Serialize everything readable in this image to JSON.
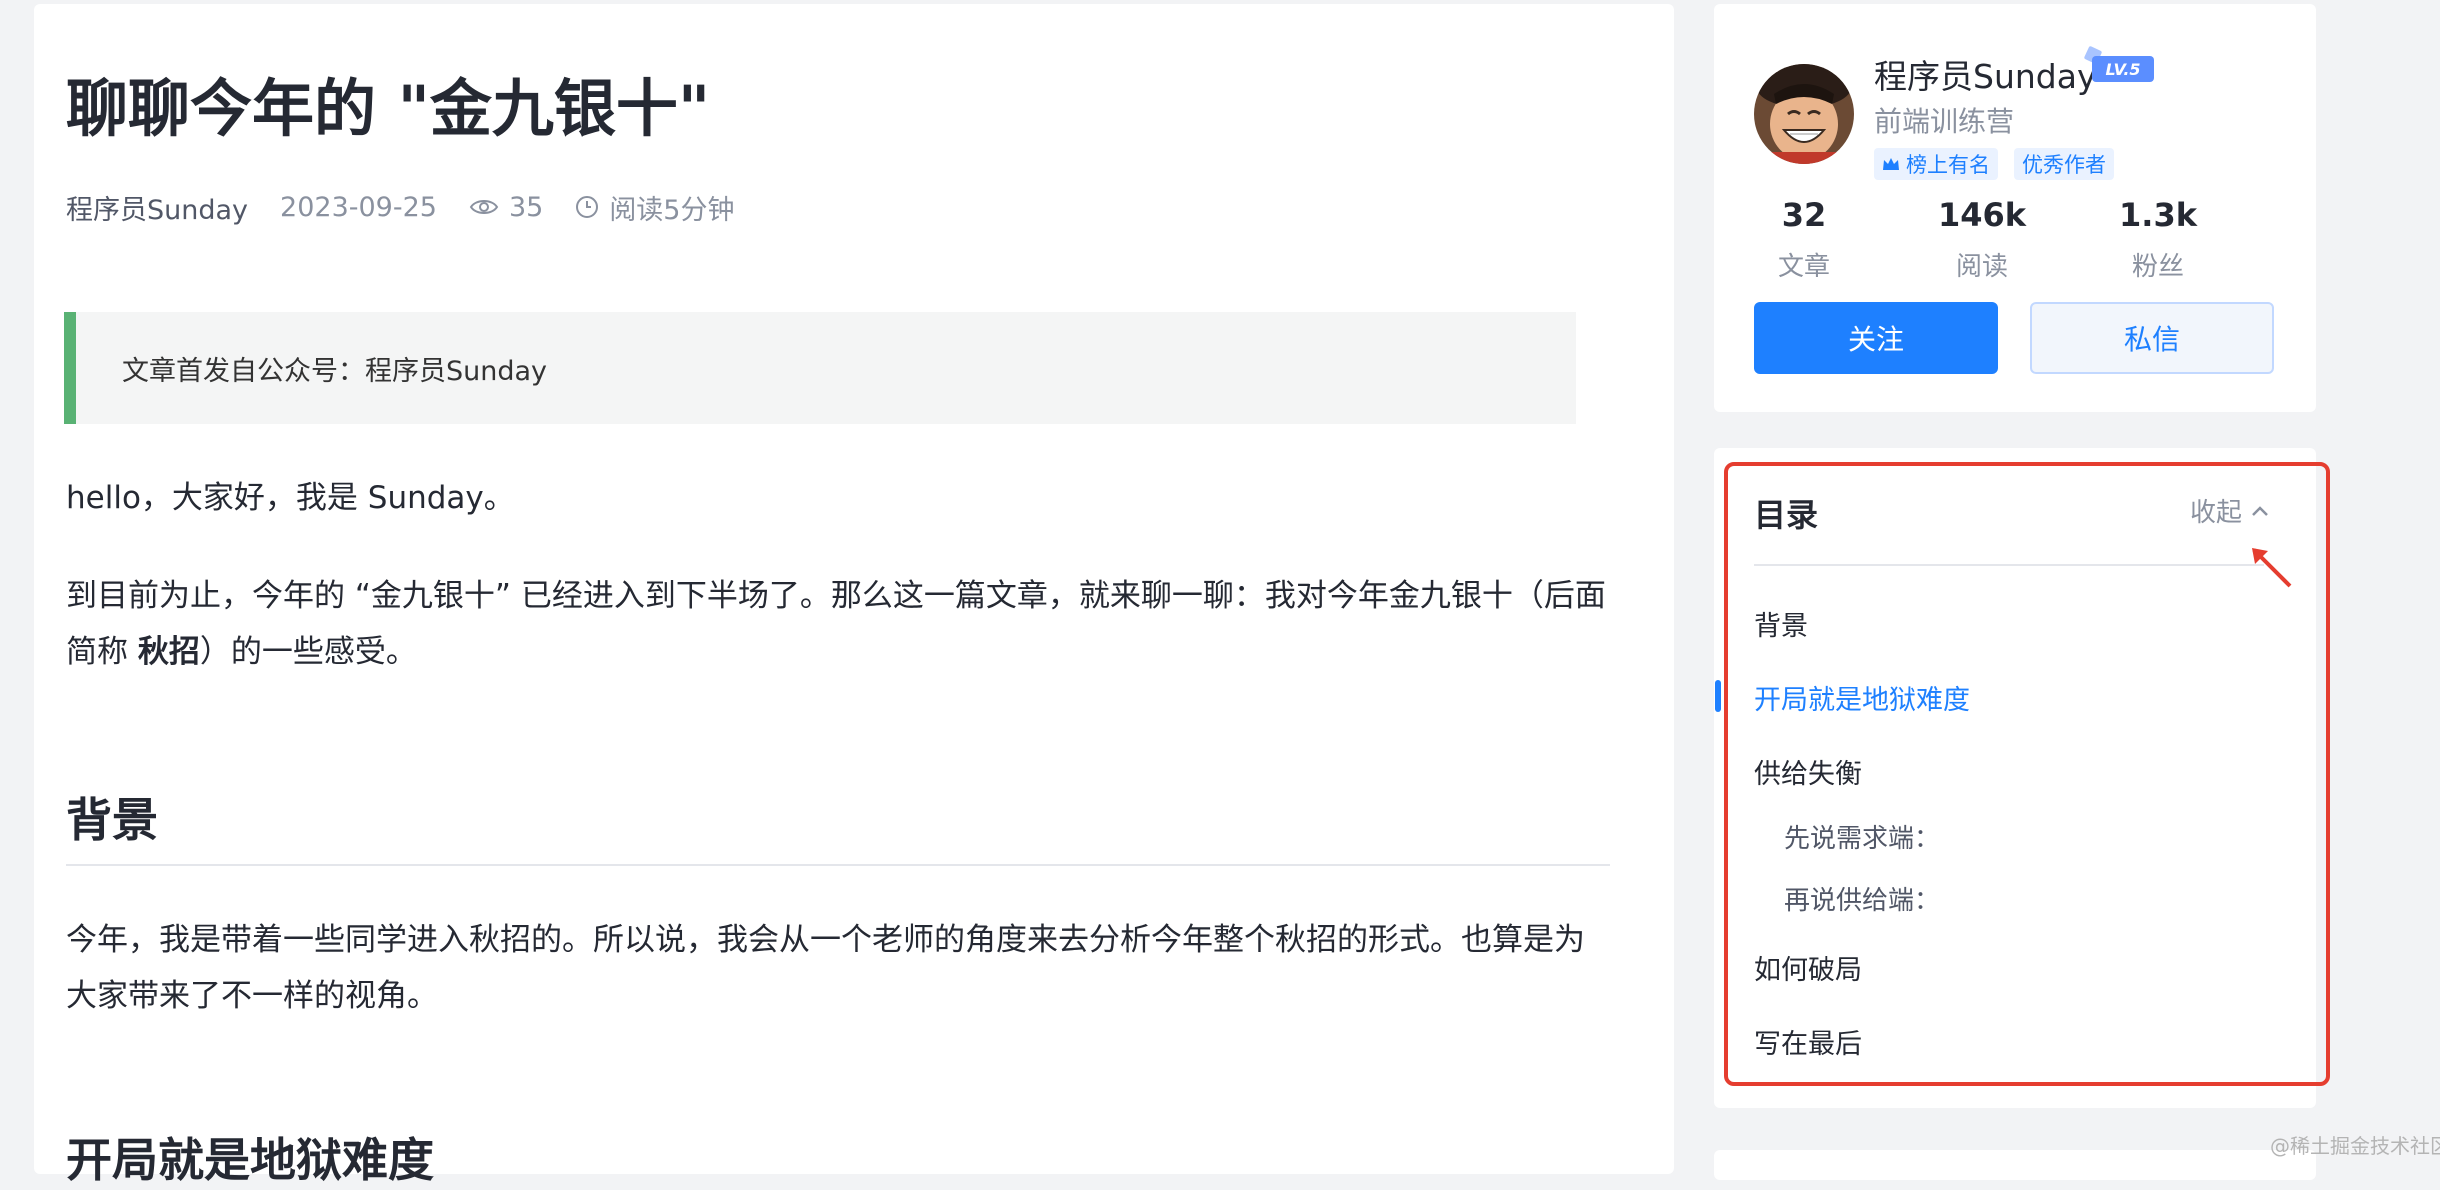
{
  "article": {
    "title": "聊聊今年的 \"金九银十\"",
    "meta": {
      "author": "程序员Sunday",
      "date": "2023-09-25",
      "views": "35",
      "read_time": "阅读5分钟"
    },
    "quote": "文章首发自公众号：程序员Sunday",
    "para1": "hello，大家好，我是 Sunday。",
    "para2_a": "到目前为止，今年的 “金九银十” 已经进入到下半场了。那么这一篇文章，就来聊一聊：我对今年金九银十（后面简称 ",
    "para2_bold": "秋招",
    "para2_b": "）的一些感受。",
    "h2_background": "背景",
    "para3": "今年，我是带着一些同学进入秋招的。所以说，我会从一个老师的角度来去分析今年整个秋招的形式。也算是为大家带来了不一样的视角。",
    "h2_next": "开局就是地狱难度"
  },
  "author_card": {
    "name": "程序员Sunday",
    "level": "LV.5",
    "subtitle": "前端训练营",
    "badges": [
      "榜上有名",
      "优秀作者"
    ],
    "stats": [
      {
        "num": "32",
        "label": "文章"
      },
      {
        "num": "146k",
        "label": "阅读"
      },
      {
        "num": "1.3k",
        "label": "粉丝"
      }
    ],
    "follow_label": "关注",
    "message_label": "私信"
  },
  "toc": {
    "title": "目录",
    "collapse_label": "收起",
    "items": [
      {
        "label": "背景",
        "level": 1,
        "active": false
      },
      {
        "label": "开局就是地狱难度",
        "level": 1,
        "active": true
      },
      {
        "label": "供给失衡",
        "level": 1,
        "active": false
      },
      {
        "label": "先说需求端：",
        "level": 2,
        "active": false
      },
      {
        "label": "再说供给端：",
        "level": 2,
        "active": false
      },
      {
        "label": "如何破局",
        "level": 1,
        "active": false
      },
      {
        "label": "写在最后",
        "level": 1,
        "active": false
      }
    ]
  },
  "colors": {
    "accent": "#1e80ff",
    "quote_border": "#59b274",
    "highlight_box": "#e53d2f"
  },
  "watermark": "@稀土掘金技术社区"
}
